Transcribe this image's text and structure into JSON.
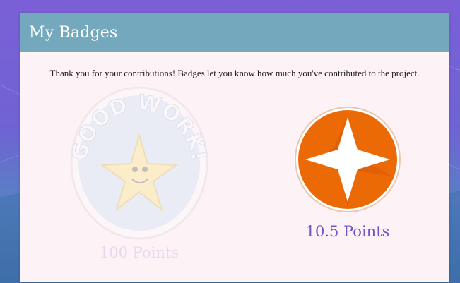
{
  "modal": {
    "title": "My Badges",
    "intro": "Thank you for your contributions! Badges let you know how much you've contributed to the project."
  },
  "badges": [
    {
      "name": "good-work",
      "art_text": "GOOD WORK!",
      "points_label": "100 Points",
      "state": "locked"
    },
    {
      "name": "star",
      "points_label": "10.5 Points",
      "state": "earned"
    }
  ],
  "colors": {
    "header": "#74a8bc",
    "modal_bg": "#fdf3f6",
    "earned_points": "#6a57c9",
    "star_badge": "#ec6a05"
  }
}
